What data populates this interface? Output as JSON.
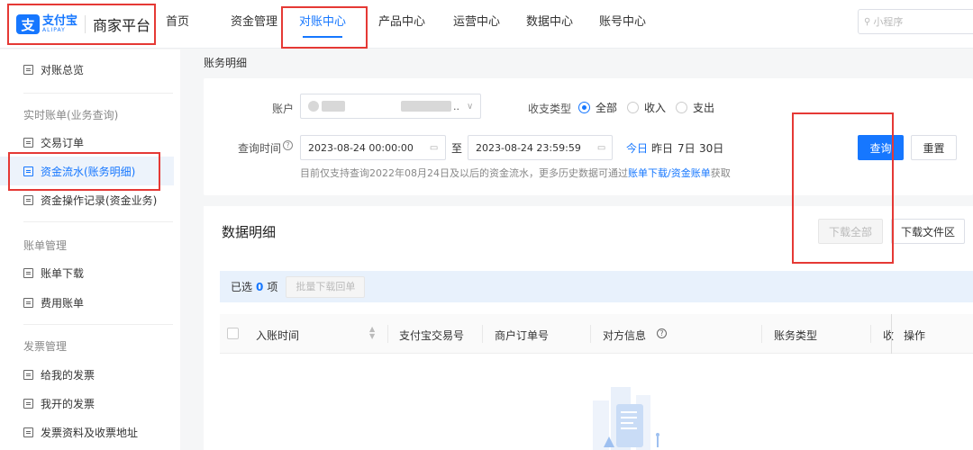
{
  "header": {
    "logo": {
      "brand_cn": "支付宝",
      "brand_en": "ALIPAY",
      "merchant": "商家平台"
    },
    "nav": [
      {
        "label": "首页"
      },
      {
        "label": "资金管理"
      },
      {
        "label": "对账中心"
      },
      {
        "label": "产品中心"
      },
      {
        "label": "运营中心"
      },
      {
        "label": "数据中心"
      },
      {
        "label": "账号中心"
      }
    ],
    "active_nav": "对账中心",
    "search_placeholder": "小程序"
  },
  "sidebar": {
    "overview": "对账总览",
    "group1": "实时账单(业务查询)",
    "items1": [
      "交易订单",
      "资金流水(账务明细)",
      "资金操作记录(资金业务)"
    ],
    "active_item": "资金流水(账务明细)",
    "group2": "账单管理",
    "items2": [
      "账单下载",
      "费用账单"
    ],
    "group3": "发票管理",
    "items3": [
      "给我的发票",
      "我开的发票",
      "发票资料及收票地址"
    ]
  },
  "breadcrumb": "账务明细",
  "filter": {
    "account_label": "账户",
    "account_suffix": "..",
    "type_label": "收支类型",
    "type_options": [
      "全部",
      "收入",
      "支出"
    ],
    "type_selected": "全部",
    "time_label": "查询时间",
    "start": "2023-08-24 00:00:00",
    "to": "至",
    "end": "2023-08-24 23:59:59",
    "quick": [
      "今日",
      "昨日",
      "7日",
      "30日"
    ],
    "quick_selected": "今日",
    "hint_prefix": "目前仅支持查询2022年08月24日及以后的资金流水，更多历史数据可通过",
    "hint_link": "账单下载/资金账单",
    "hint_suffix": "获取",
    "query_btn": "查询",
    "reset_btn": "重置"
  },
  "table": {
    "title": "数据明细",
    "download_all": "下载全部",
    "download_area": "下载文件区",
    "selected_prefix": "已选",
    "selected_count": "0",
    "selected_suffix": "项",
    "batch_btn": "批量下载回单",
    "columns": [
      "入账时间",
      "支付宝交易号",
      "商户订单号",
      "对方信息",
      "账务类型",
      "收",
      "操作"
    ]
  },
  "colors": {
    "accent": "#1677ff",
    "highlight": "#e53935"
  }
}
